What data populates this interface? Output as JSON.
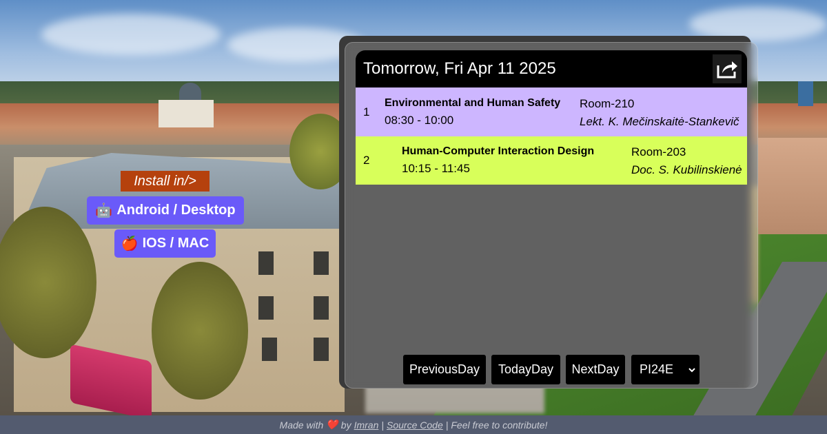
{
  "install": {
    "label": "Install in/>",
    "android": {
      "icon": "🤖",
      "label": "Android / Desktop"
    },
    "ios": {
      "icon": "🍎",
      "label": "IOS / MAC"
    }
  },
  "schedule": {
    "header_title": "Tomorrow, Fri Apr 11 2025",
    "share_icon": "share-icon",
    "lessons": [
      {
        "number": "1",
        "subject": "Environmental and Human Safety",
        "time": "08:30 - 10:00",
        "room": "Room-210",
        "teacher": "Lekt. K. Mečinskaitė-Stankevič",
        "color": "#cdb6ff"
      },
      {
        "number": "2",
        "subject": "Human-Computer Interaction Design",
        "time": "10:15 - 11:45",
        "room": "Room-203",
        "teacher": "Doc. S. Kubilinskienė",
        "color": "#d8ff5a"
      }
    ]
  },
  "controls": {
    "previous": "PreviousDay",
    "today": "TodayDay",
    "next": "NextDay",
    "group_selected": "PI24E"
  },
  "footer": {
    "made_with": "Made with",
    "heart": "❤️",
    "by": "by",
    "author": "Imran",
    "separator": "|",
    "source": "Source Code",
    "feel_free": "Feel free to contribute!"
  },
  "colors": {
    "install_label_bg": "#b5410d",
    "install_btn_bg": "#6a5af9",
    "footer_bg": "#535b6f",
    "header_bg": "#000000"
  }
}
